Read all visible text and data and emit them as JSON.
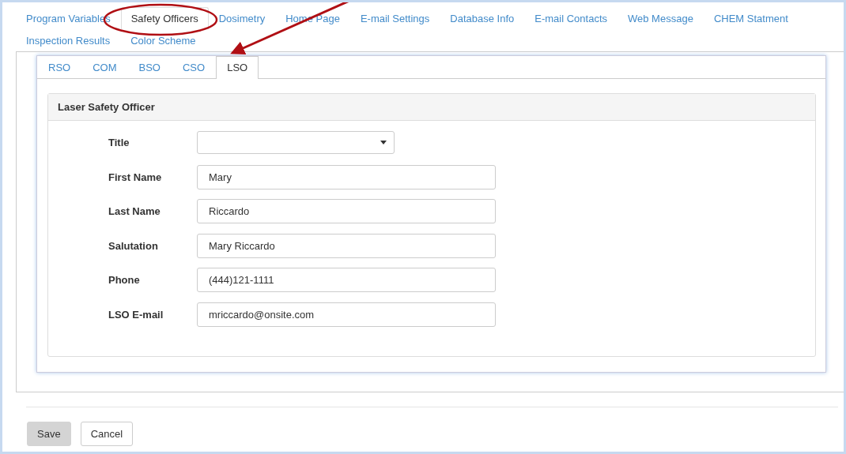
{
  "main_tabs": [
    {
      "label": "Program Variables",
      "selected": false
    },
    {
      "label": "Safety Officers",
      "selected": true
    },
    {
      "label": "Dosimetry",
      "selected": false
    },
    {
      "label": "Home Page",
      "selected": false
    },
    {
      "label": "E-mail Settings",
      "selected": false
    },
    {
      "label": "Database Info",
      "selected": false
    },
    {
      "label": "E-mail Contacts",
      "selected": false
    },
    {
      "label": "Web Message",
      "selected": false
    },
    {
      "label": "CHEM Statment",
      "selected": false
    },
    {
      "label": "Inspection Results",
      "selected": false
    },
    {
      "label": "Color Scheme",
      "selected": false
    }
  ],
  "officer_tabs": [
    {
      "label": "RSO",
      "selected": false
    },
    {
      "label": "COM",
      "selected": false
    },
    {
      "label": "BSO",
      "selected": false
    },
    {
      "label": "CSO",
      "selected": false
    },
    {
      "label": "LSO",
      "selected": true
    }
  ],
  "panel": {
    "title": "Laser Safety Officer",
    "fields": [
      {
        "label": "Title",
        "kind": "select"
      },
      {
        "label": "First Name",
        "kind": "text",
        "value": "Mary"
      },
      {
        "label": "Last Name",
        "kind": "text",
        "value": "Riccardo"
      },
      {
        "label": "Salutation",
        "kind": "text",
        "value": "Mary Riccardo"
      },
      {
        "label": "Phone",
        "kind": "text",
        "value": "(444)121-1111"
      },
      {
        "label": "LSO E-mail",
        "kind": "text",
        "value": "mriccardo@onsite.com"
      }
    ]
  },
  "buttons": [
    {
      "label": "Save",
      "kind": "primary"
    },
    {
      "label": "Cancel",
      "kind": "default"
    }
  ]
}
